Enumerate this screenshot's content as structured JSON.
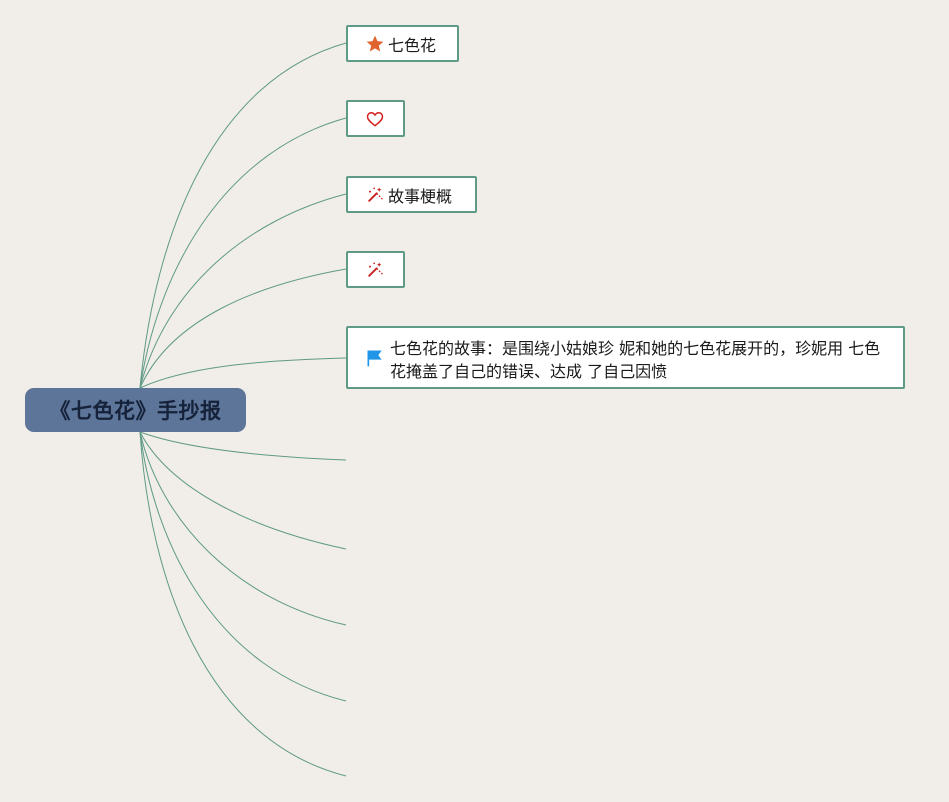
{
  "root": {
    "title": "《七色花》手抄报"
  },
  "topics": [
    {
      "icon": "star-icon",
      "label": "七色花"
    },
    {
      "icon": "heart-icon",
      "label": ""
    },
    {
      "icon": "magic-wand-icon",
      "label": "故事梗概"
    },
    {
      "icon": "magic-wand-icon",
      "label": ""
    },
    {
      "icon": "flag-icon",
      "label": "七色花的故事：是围绕小姑娘珍 妮和她的七色花展开的，珍妮用 七色花掩盖了自己的错误、达成 了自己因愤"
    }
  ],
  "empty_branches": 5,
  "colors": {
    "background": "#f1ede8",
    "root_fill": "#5d7599",
    "root_text": "#15223a",
    "connector": "#5f9a86",
    "star": "#e0622e",
    "heart": "#d42020",
    "wand": "#c81e1e",
    "flag": "#2196e8"
  }
}
